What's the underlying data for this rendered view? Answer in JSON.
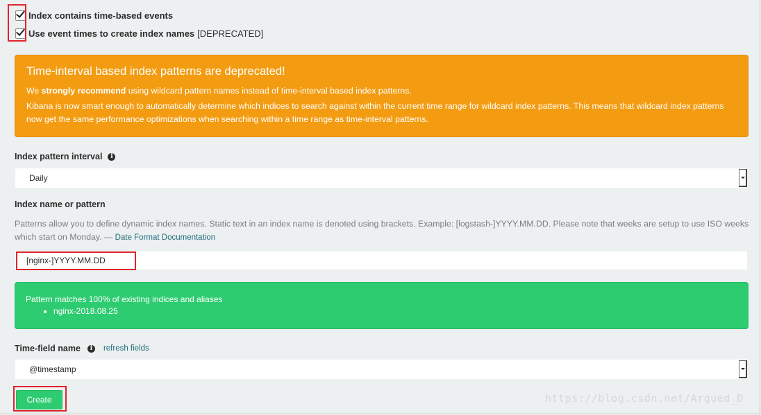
{
  "options": {
    "time_based": {
      "label": "Index contains time-based events",
      "checked": true
    },
    "event_times": {
      "label": "Use event times to create index names",
      "suffix": "[DEPRECATED]",
      "checked": true
    }
  },
  "deprecation_callout": {
    "title": "Time-interval based index patterns are deprecated!",
    "line1_prefix": "We",
    "line1_strong": "strongly recommend",
    "line1_suffix": "using wildcard pattern names instead of time-interval based index patterns.",
    "line2": "Kibana is now smart enough to automatically determine which indices to search against within the current time range for wildcard index patterns. This means that wildcard index patterns now get the same performance optimizations when searching within a time range as time-interval patterns."
  },
  "interval": {
    "label": "Index pattern interval",
    "info_icon": "info-icon",
    "value": "Daily"
  },
  "pattern": {
    "label": "Index name or pattern",
    "help": "Patterns allow you to define dynamic index names. Static text in an index name is denoted using brackets. Example: [logstash-]YYYY.MM.DD. Please note that weeks are setup to use ISO weeks which start on Monday. —",
    "doc_link": "Date Format Documentation",
    "value": "[nginx-]YYYY.MM.DD"
  },
  "match_callout": {
    "message": "Pattern matches 100% of existing indices and aliases",
    "indices": [
      "nginx-2018.08.25"
    ]
  },
  "time_field": {
    "label": "Time-field name",
    "info_icon": "info-icon",
    "refresh_link": "refresh fields",
    "value": "@timestamp"
  },
  "create_button": "Create",
  "watermark": "https://blog.csdn.net/Argued_D",
  "colors": {
    "background": "#ecf0f1",
    "warning": "#f39c12",
    "success": "#2ecc71",
    "link": "#1f6b7a",
    "highlight": "#e0242b"
  }
}
